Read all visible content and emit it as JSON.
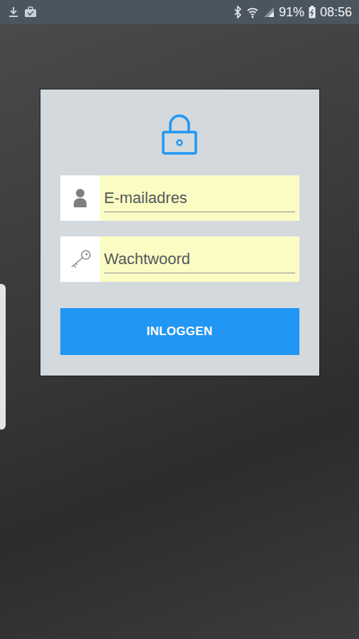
{
  "status_bar": {
    "battery": "91%",
    "time": "08:56"
  },
  "login": {
    "fields": [
      {
        "kind": "email",
        "placeholder": "E-mailadres"
      },
      {
        "kind": "password",
        "placeholder": "Wachtwoord"
      }
    ],
    "button": "INLOGGEN"
  }
}
